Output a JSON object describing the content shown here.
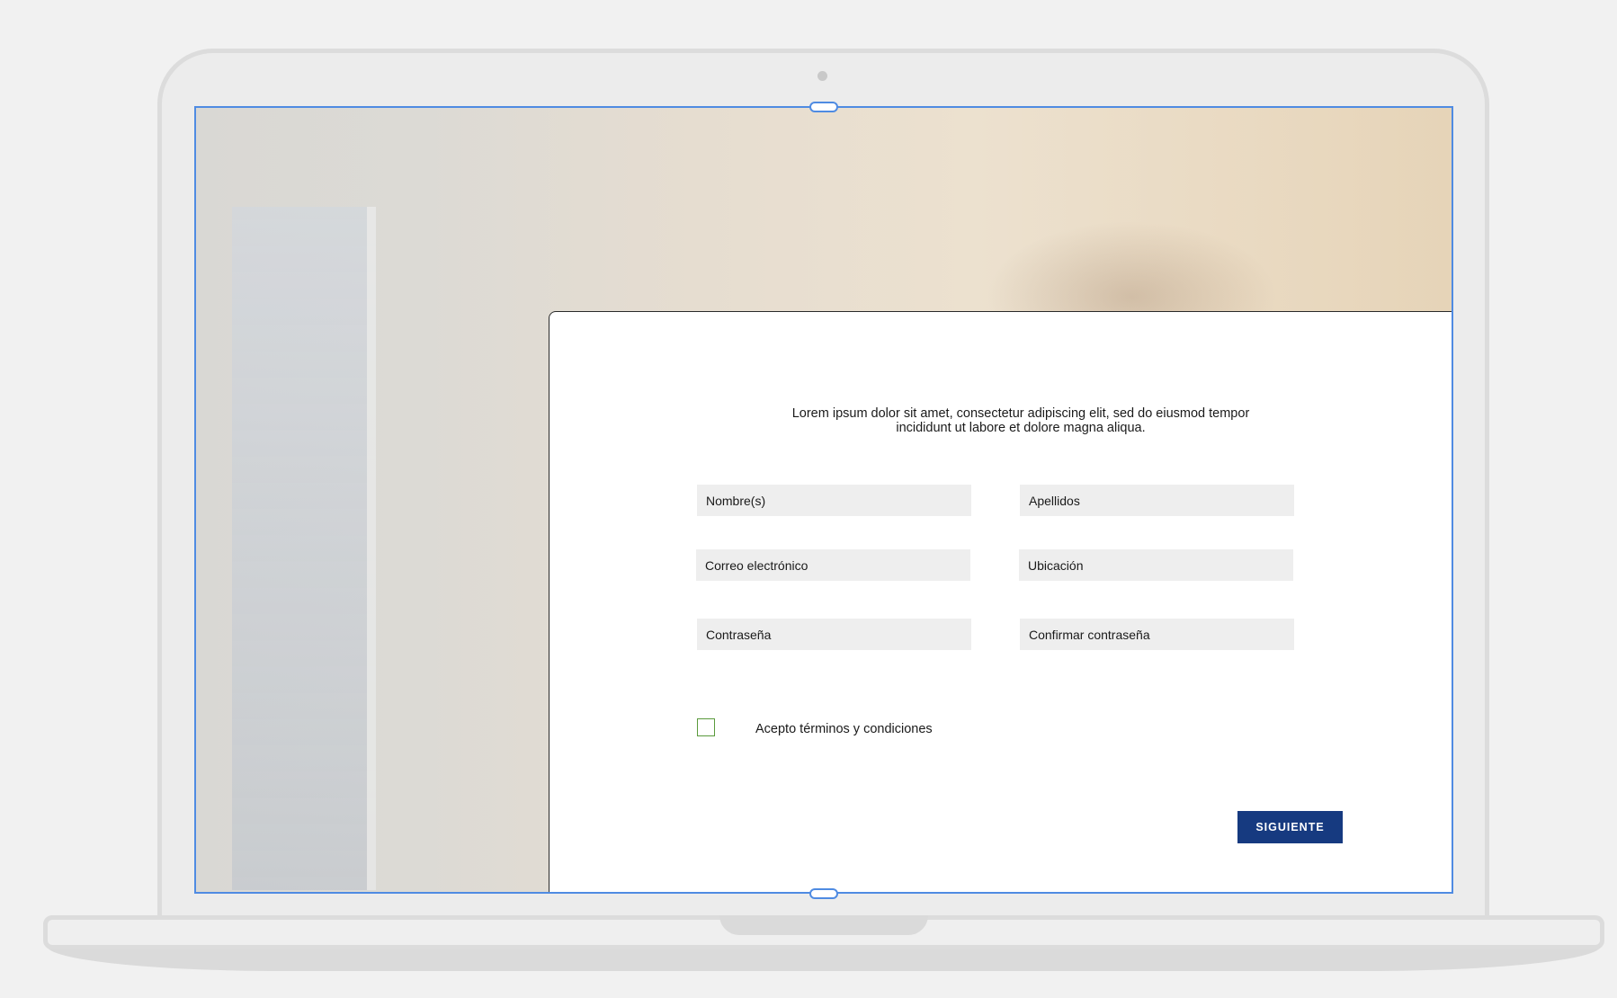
{
  "form": {
    "intro_line_1": "Lorem ipsum dolor sit amet, consectetur adipiscing elit, sed do eiusmod tempor",
    "intro_line_2": "incididunt ut labore et dolore magna aliqua.",
    "fields": {
      "first_name": {
        "placeholder": "Nombre(s)",
        "value": ""
      },
      "last_name": {
        "placeholder": "Apellidos",
        "value": ""
      },
      "email": {
        "placeholder": "Correo electrónico",
        "value": ""
      },
      "location": {
        "placeholder": "Ubicación",
        "value": ""
      },
      "password": {
        "placeholder": "Contraseña",
        "value": ""
      },
      "confirm_password": {
        "placeholder": "Confirmar contraseña",
        "value": ""
      }
    },
    "terms": {
      "label": "Acepto términos y condiciones",
      "checked": false
    },
    "next_button_label": "SIGUIENTE"
  },
  "colors": {
    "primary_button": "#163a80",
    "selection_outline": "#4f8be2",
    "checkbox_border": "#5a9a3c",
    "field_background": "#eeeeee"
  }
}
